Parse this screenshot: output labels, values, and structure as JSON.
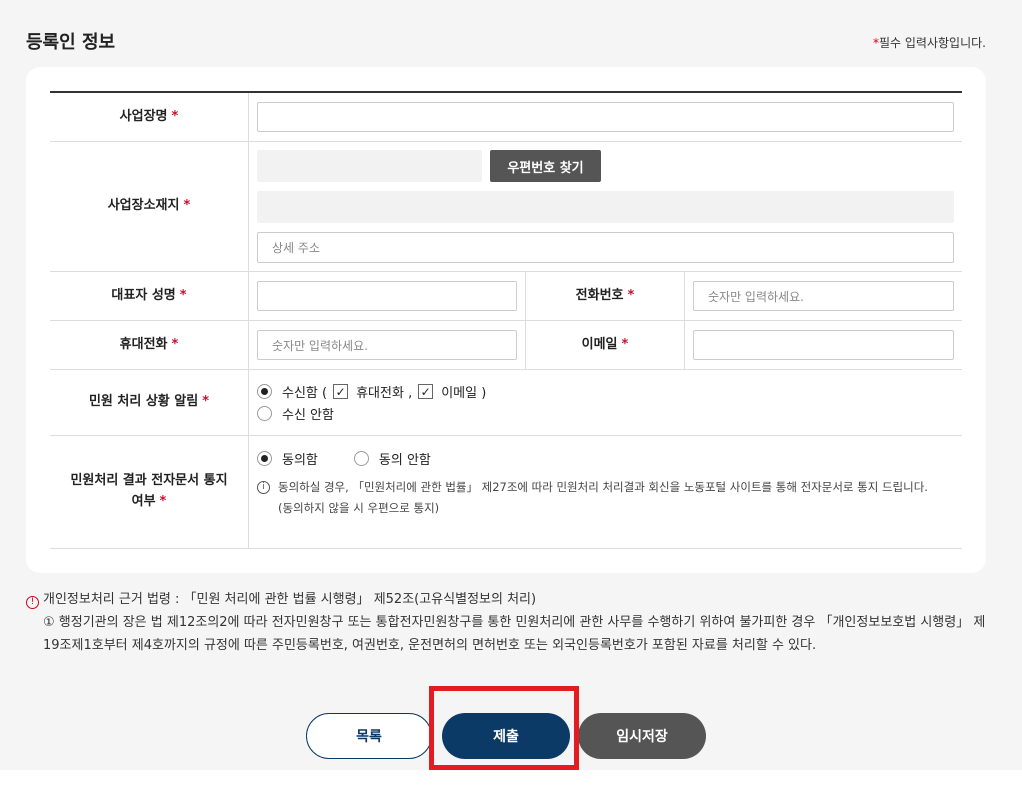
{
  "page": {
    "title": "등록인 정보",
    "required_star": "*",
    "required_text": "필수 입력사항입니다."
  },
  "form": {
    "business_name": {
      "label": "사업장명",
      "star": "*",
      "value": ""
    },
    "address": {
      "label": "사업장소재지",
      "star": "*",
      "postcode_value": "",
      "find_button": "우편번호 찾기",
      "address_value": "",
      "detail_placeholder": "상세 주소"
    },
    "rep_name": {
      "label": "대표자 성명",
      "star": "*",
      "value": ""
    },
    "phone": {
      "label": "전화번호",
      "star": "*",
      "placeholder": "숫자만 입력하세요."
    },
    "mobile": {
      "label": "휴대전화",
      "star": "*",
      "placeholder": "숫자만 입력하세요."
    },
    "email": {
      "label": "이메일",
      "star": "*",
      "value": ""
    },
    "notify": {
      "label": "민원 처리 상황 알림",
      "star": "*",
      "receive_prefix": "수신함 (",
      "mobile_label": "휴대전화 ,",
      "email_label": "이메일 )",
      "no_receive": "수신 안함"
    },
    "edoc": {
      "label_line1": "민원처리 결과 전자문서 통지",
      "label_line2": "여부",
      "star": "*",
      "agree": "동의함",
      "disagree": "동의 안함",
      "notice_icon": "i",
      "notice_line1": "동의하실 경우, 「민원처리에 관한 법률」 제27조에 따라 민원처리 처리결과 회신을 노동포털 사이트를 통해 전자문서로 통지 드립니다.",
      "notice_line2": "(동의하지 않을 시 우편으로 통지)"
    }
  },
  "legal": {
    "icon": "!",
    "title": "개인정보처리 근거 법령 : 「민원 처리에 관한 법률 시행령」 제52조(고유식별정보의 처리)",
    "body": "① 행정기관의 장은 법 제12조의2에 따라 전자민원창구 또는 통합전자민원창구를 통한 민원처리에 관한 사무를 수행하기 위하여 불가피한 경우 「개인정보보호법 시행령」 제19조제1호부터 제4호까지의 규정에 따른 주민등록번호, 여권번호, 운전면허의 면허번호 또는 외국인등록번호가 포함된 자료를 처리할 수 있다."
  },
  "buttons": {
    "list": "목록",
    "submit": "제출",
    "temp_save": "임시저장"
  },
  "colors": {
    "primary": "#0b3a66",
    "dark_button": "#555555",
    "required": "#c8102e",
    "highlight": "#e31b23"
  }
}
